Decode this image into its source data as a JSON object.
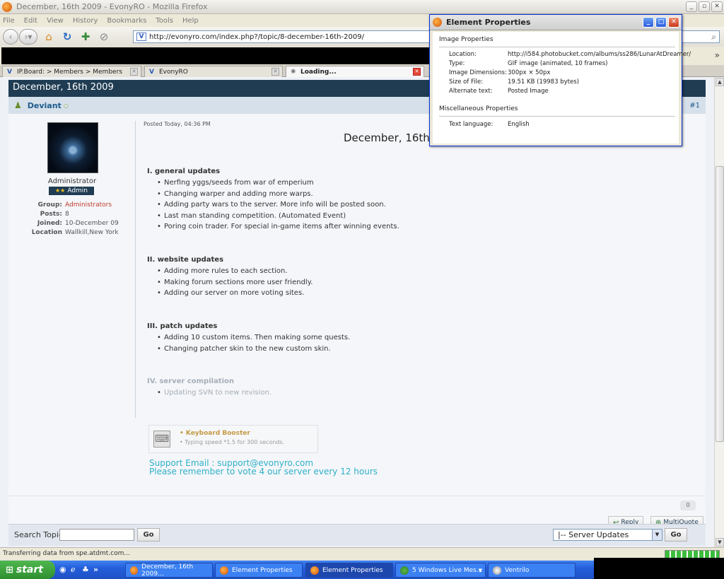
{
  "window": {
    "title": "December, 16th 2009 - EvonyRO - Mozilla Firefox",
    "controls": [
      "_",
      "▫",
      "✕"
    ]
  },
  "menu": [
    "File",
    "Edit",
    "View",
    "History",
    "Bookmarks",
    "Tools",
    "Help"
  ],
  "url": "http://evonyro.com/index.php?/topic/8-december-16th-2009/",
  "tabs": [
    {
      "label": "IP.Board: > Members > Members"
    },
    {
      "label": "EvonyRO"
    },
    {
      "label": "Loading..."
    }
  ],
  "topic": {
    "header": "December, 16th 2009",
    "author": "Deviant",
    "post_number": "#1",
    "posted": "Posted Today, 04:36 PM",
    "title": "December, 16th"
  },
  "profile": {
    "rank": "Administrator",
    "badge": "Admin",
    "badge_stars": "★★",
    "fields": [
      {
        "key": "Group:",
        "value": "Administrators"
      },
      {
        "key": "Posts:",
        "value": "8"
      },
      {
        "key": "Joined:",
        "value": "10-December 09"
      },
      {
        "key": "Location",
        "value": "Wallkill,New York"
      }
    ]
  },
  "sections": [
    {
      "heading": "I. general updates",
      "items": [
        "Nerfing yggs/seeds from war of emperium",
        "Changing warper and adding more warps.",
        "Adding party wars to the server. More info will be posted soon.",
        "Last man standing competition. (Automated Event)",
        "Poring coin trader. For special in-game items after winning events."
      ]
    },
    {
      "heading": "II. website updates",
      "items": [
        "Adding more rules to each section.",
        "Making forum sections more user friendly.",
        "Adding our server on more voting sites."
      ]
    },
    {
      "heading": "III. patch updates",
      "items": [
        "Adding 10 custom items. Then making some quests.",
        "Changing patcher skin to the new custom skin."
      ]
    },
    {
      "heading": "IV. server compilation",
      "items": [
        "Updating SVN to new revision."
      ]
    }
  ],
  "booster": {
    "title": "Keyboard Booster",
    "desc": "Typing speed *1.5 for 300 seconds."
  },
  "signature": {
    "line1": "Support Email : support@evonyro.com",
    "line2": "Please remember to vote 4 our server every 12 hours"
  },
  "post_actions": {
    "reputation": "0",
    "reply": "Reply",
    "multiquote": "MultiQuote"
  },
  "footer": {
    "search_label": "Search Topic",
    "search_value": "",
    "go": "Go",
    "forum_select": "|-- Server Updates",
    "go2": "Go"
  },
  "status": {
    "text": "Transferring data from spe.atdmt.com...",
    "progress": 1.0
  },
  "taskbar": {
    "start": "start",
    "buttons": [
      {
        "label": "December, 16th 2009...",
        "icon": "firefox-icon"
      },
      {
        "label": "Element Properties",
        "icon": "firefox-icon"
      },
      {
        "label": "Element Properties",
        "icon": "firefox-icon"
      },
      {
        "label": "5 Windows Live Mes...",
        "icon": "msn-icon"
      },
      {
        "label": "Ventrilo",
        "icon": "ventrilo-icon"
      }
    ]
  },
  "dialog": {
    "title": "Element Properties",
    "section1": "Image Properties",
    "rows": [
      {
        "key": "Location:",
        "value": "http://i584.photobucket.com/albums/ss286/LunarAtDreamer/"
      },
      {
        "key": "Type:",
        "value": "GIF image (animated, 10 frames)"
      },
      {
        "key": "Image Dimensions:",
        "value": "300px × 50px"
      },
      {
        "key": "Size of File:",
        "value": "19.51 KB (19983 bytes)"
      },
      {
        "key": "Alternate text:",
        "value": "Posted Image"
      }
    ],
    "section2": "Miscellaneous Properties",
    "lang_key": "Text language:",
    "lang_value": "English"
  },
  "colors": {
    "topic_header": "#1f3c53",
    "author_name": "#1d5a8c",
    "signature": "#2fb0c8",
    "booster_title": "#c49a44"
  }
}
